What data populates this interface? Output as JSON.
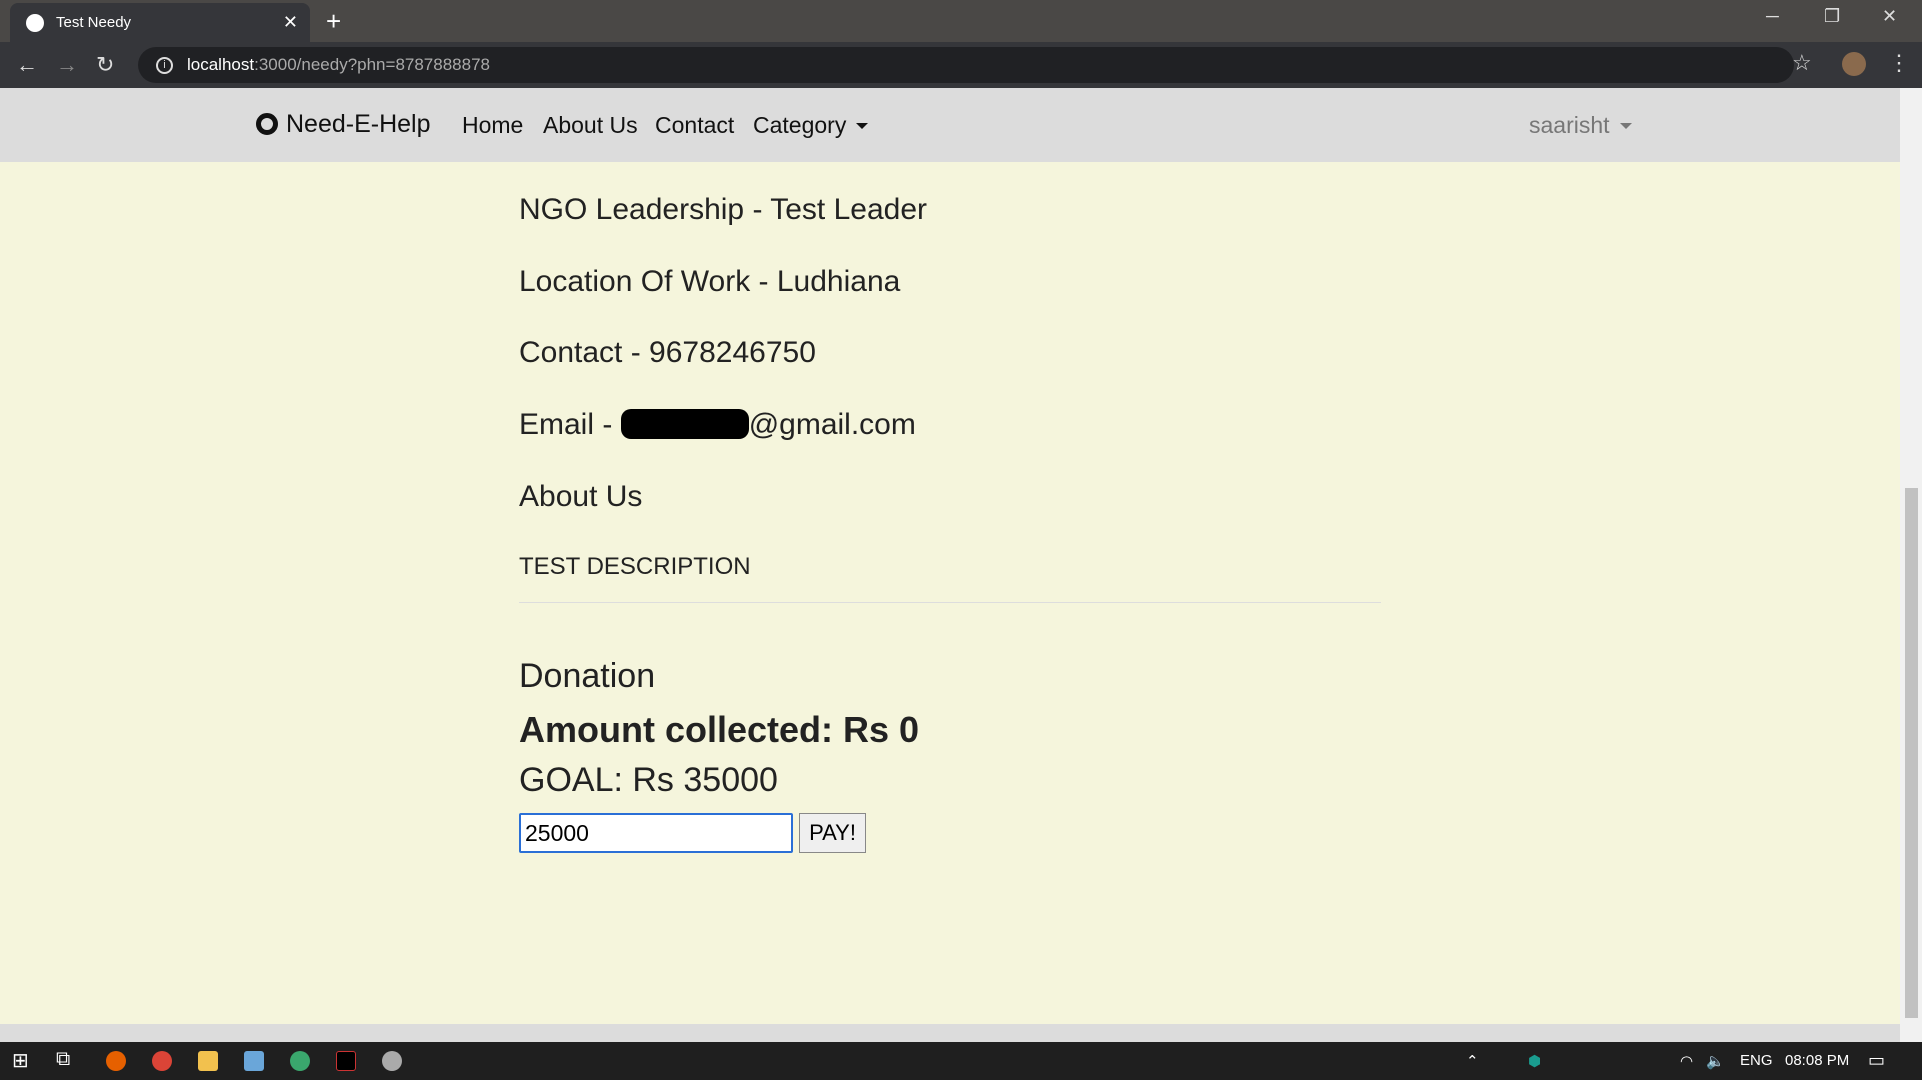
{
  "browser": {
    "tab_title": "Test Needy",
    "url_host": "localhost",
    "url_rest": ":3000/needy?phn=8787888878"
  },
  "navbar": {
    "brand": "Need-E-Help",
    "links": [
      "Home",
      "About Us",
      "Contact",
      "Category"
    ],
    "user": "saarisht"
  },
  "profile": {
    "leadership": "NGO Leadership - Test Leader",
    "location": "Location Of Work - Ludhiana",
    "contact": "Contact - 9678246750",
    "email_prefix": "Email - ",
    "email_suffix": "@gmail.com",
    "about_heading": "About Us",
    "description": "TEST DESCRIPTION"
  },
  "donation": {
    "heading": "Donation",
    "collected": "Amount collected: Rs 0",
    "goal": "GOAL: Rs 35000",
    "amount_value": "25000",
    "pay_label": "PAY!"
  },
  "taskbar": {
    "lang": "ENG",
    "time": "08:08 PM"
  }
}
